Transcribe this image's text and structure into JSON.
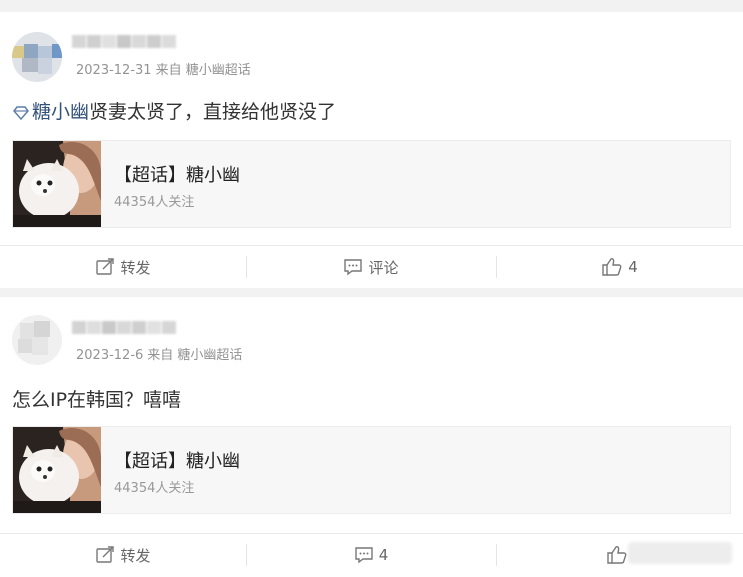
{
  "posts": [
    {
      "date": "2023-12-31",
      "source": "来自 糖小幽超话",
      "topic_link": "糖小幽",
      "text": "贤妻太贤了，直接给他贤没了",
      "topic_card": {
        "title": "【超话】糖小幽",
        "followers": "44354人关注"
      },
      "actions": {
        "repost": "转发",
        "comment": "评论",
        "like": "4"
      }
    },
    {
      "date": "2023-12-6",
      "source": "来自 糖小幽超话",
      "text": "怎么IP在韩国？嘻嘻",
      "topic_card": {
        "title": "【超话】糖小幽",
        "followers": "44354人关注"
      },
      "actions": {
        "repost": "转发",
        "comment": "4",
        "like": ""
      }
    }
  ],
  "icons": {
    "repost": "repost-icon",
    "comment": "comment-icon",
    "like": "thumbs-up-icon",
    "topic": "diamond-icon"
  },
  "colors": {
    "link": "#33527a",
    "meta": "#939393",
    "background": "#f2f2f2"
  }
}
